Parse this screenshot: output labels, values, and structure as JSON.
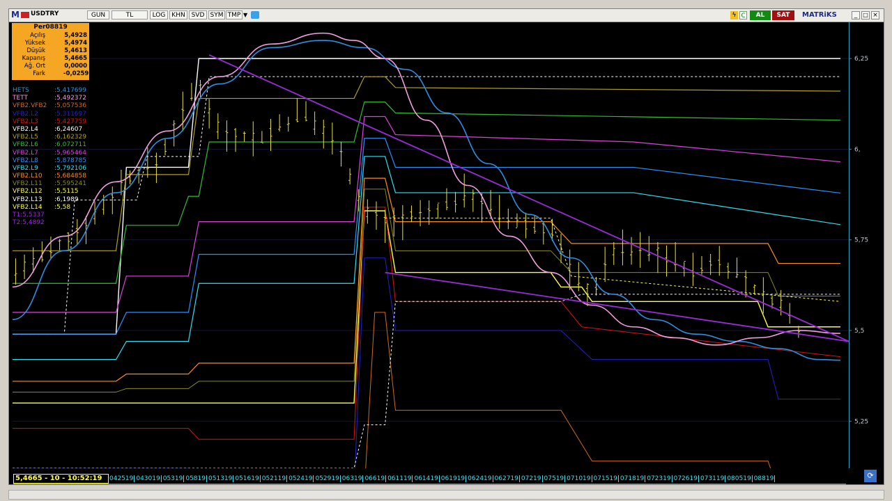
{
  "toolbar": {
    "symbol": "USDTRY",
    "buttons": [
      "GUN",
      "TL",
      "LOG",
      "KHN",
      "SVD",
      "SYM",
      "TMP"
    ],
    "al_label": "AL",
    "sat_label": "SAT",
    "brand": "MATRiKS"
  },
  "ohlc": {
    "title": "Per08819",
    "rows": [
      {
        "k": "Açılış",
        "v": "5,4928"
      },
      {
        "k": "Yüksek",
        "v": "5,4974"
      },
      {
        "k": "Düşük",
        "v": "5,4613"
      },
      {
        "k": "Kapanış",
        "v": "5,4665"
      },
      {
        "k": "Ağ. Ort",
        "v": "0,0000"
      },
      {
        "k": "Fark",
        "v": "-0,0259"
      }
    ]
  },
  "legend": [
    {
      "name": "HETS",
      "value": ":5,417699",
      "color": "#2d8fe0"
    },
    {
      "name": "TETT",
      "value": ":5,492372",
      "color": "#f29ee0"
    },
    {
      "name": "VFB2.VFB2",
      "value": ":5,057536",
      "color": "#d46a1a"
    },
    {
      "name": "VFB2.L2",
      "value": ":5,311697",
      "color": "#2222cc"
    },
    {
      "name": "VFB2.L3",
      "value": ":5,427759",
      "color": "#e01010"
    },
    {
      "name": "VFB2.L4",
      "value": ":6,24607",
      "color": "#ffffff"
    },
    {
      "name": "VFB2.L5",
      "value": ":6,162329",
      "color": "#b0a020"
    },
    {
      "name": "VFB2.L6",
      "value": ":6,072711",
      "color": "#2fbf2f"
    },
    {
      "name": "VFB2.L7",
      "value": ":5,965464",
      "color": "#e040e0"
    },
    {
      "name": "VFB2.L8",
      "value": ":5,878785",
      "color": "#2a90ff"
    },
    {
      "name": "VFB2.L9",
      "value": ":5,792106",
      "color": "#30e0f0"
    },
    {
      "name": "VFB2.L10",
      "value": ":5,684858",
      "color": "#ff8c1a"
    },
    {
      "name": "VFB2.L11",
      "value": ":5,595241",
      "color": "#8a8a1a"
    },
    {
      "name": "VFB2.L12",
      "value": ":5,5115",
      "color": "#ffff40"
    },
    {
      "name": "VFB2.L13",
      "value": ":6,1989",
      "color": "#ffffff"
    },
    {
      "name": "VFB2.L14",
      "value": ":5,58",
      "color": "#ffff40"
    },
    {
      "name": "T1:5,5337",
      "value": "",
      "color": "#9a2bd8"
    },
    {
      "name": "T2:5,4892",
      "value": "",
      "color": "#9a2bd8"
    }
  ],
  "ticker": {
    "current": "5,4665 - 10 - 10:52:19",
    "dates": [
      "042519",
      "043019",
      "05319",
      "05819",
      "051319",
      "051619",
      "052119",
      "052419",
      "052919",
      "06319",
      "06619",
      "061119",
      "061419",
      "061919",
      "062419",
      "062719",
      "07219",
      "07519",
      "071019",
      "071519",
      "071819",
      "072319",
      "072619",
      "073119",
      "080519",
      "08819"
    ]
  },
  "chart_data": {
    "type": "line",
    "ylim": [
      5.12,
      6.35
    ],
    "y_ticks": [
      "6,25",
      "6,",
      "5,75",
      "5,5",
      "5,25"
    ],
    "y_tick_values": [
      6.25,
      6.0,
      5.75,
      5.5,
      5.25
    ],
    "x_count": 80,
    "step_lines": [
      {
        "name": "L4",
        "color": "#ffffff",
        "width": 1.4,
        "dash": false,
        "points": [
          [
            0,
            5.49
          ],
          [
            10,
            5.49
          ],
          [
            11,
            5.95
          ],
          [
            17,
            5.95
          ],
          [
            18,
            6.25
          ],
          [
            80,
            6.25
          ]
        ]
      },
      {
        "name": "L13",
        "color": "#ffffff",
        "width": 1,
        "dash": true,
        "points": [
          [
            0,
            5.49
          ],
          [
            5,
            5.49
          ],
          [
            6,
            5.86
          ],
          [
            12,
            5.86
          ],
          [
            13,
            5.98
          ],
          [
            18,
            5.98
          ],
          [
            19,
            6.2
          ],
          [
            34,
            6.2
          ],
          [
            35,
            6.2
          ],
          [
            80,
            6.2
          ]
        ]
      },
      {
        "name": "L5",
        "color": "#b0a020",
        "width": 1.2,
        "dash": false,
        "points": [
          [
            0,
            5.72
          ],
          [
            10,
            5.72
          ],
          [
            11,
            5.93
          ],
          [
            17,
            5.93
          ],
          [
            18,
            6.14
          ],
          [
            33,
            6.14
          ],
          [
            34,
            6.2
          ],
          [
            36,
            6.2
          ],
          [
            37,
            6.17
          ],
          [
            80,
            6.16
          ]
        ]
      },
      {
        "name": "L6",
        "color": "#2fbf2f",
        "width": 1.2,
        "dash": false,
        "points": [
          [
            0,
            5.63
          ],
          [
            10,
            5.63
          ],
          [
            11,
            5.79
          ],
          [
            16,
            5.79
          ],
          [
            17,
            5.87
          ],
          [
            18,
            5.87
          ],
          [
            19,
            6.02
          ],
          [
            32,
            6.02
          ],
          [
            33,
            6.02
          ],
          [
            34,
            6.13
          ],
          [
            36,
            6.13
          ],
          [
            37,
            6.1
          ],
          [
            80,
            6.08
          ]
        ]
      },
      {
        "name": "L7",
        "color": "#e040e0",
        "width": 1.2,
        "dash": false,
        "points": [
          [
            0,
            5.55
          ],
          [
            10,
            5.55
          ],
          [
            11,
            5.65
          ],
          [
            17,
            5.65
          ],
          [
            18,
            5.8
          ],
          [
            33,
            5.8
          ],
          [
            34,
            6.09
          ],
          [
            36,
            6.09
          ],
          [
            37,
            6.04
          ],
          [
            60,
            6.02
          ],
          [
            80,
            5.965
          ]
        ]
      },
      {
        "name": "L8",
        "color": "#2a90ff",
        "width": 1.2,
        "dash": false,
        "points": [
          [
            0,
            5.49
          ],
          [
            10,
            5.49
          ],
          [
            11,
            5.55
          ],
          [
            17,
            5.55
          ],
          [
            18,
            5.71
          ],
          [
            33,
            5.71
          ],
          [
            34,
            6.03
          ],
          [
            36,
            6.03
          ],
          [
            37,
            5.95
          ],
          [
            60,
            5.95
          ],
          [
            80,
            5.879
          ]
        ]
      },
      {
        "name": "L9",
        "color": "#30e0f0",
        "width": 1.2,
        "dash": false,
        "points": [
          [
            0,
            5.42
          ],
          [
            10,
            5.42
          ],
          [
            11,
            5.47
          ],
          [
            17,
            5.47
          ],
          [
            18,
            5.63
          ],
          [
            33,
            5.63
          ],
          [
            34,
            5.98
          ],
          [
            36,
            5.98
          ],
          [
            37,
            5.88
          ],
          [
            60,
            5.88
          ],
          [
            80,
            5.792
          ]
        ]
      },
      {
        "name": "L10",
        "color": "#ff8c1a",
        "width": 1.2,
        "dash": false,
        "points": [
          [
            0,
            5.36
          ],
          [
            10,
            5.36
          ],
          [
            11,
            5.38
          ],
          [
            17,
            5.38
          ],
          [
            18,
            5.41
          ],
          [
            33,
            5.41
          ],
          [
            34,
            5.92
          ],
          [
            36,
            5.92
          ],
          [
            37,
            5.8
          ],
          [
            52,
            5.8
          ],
          [
            54,
            5.74
          ],
          [
            73,
            5.74
          ],
          [
            74,
            5.685
          ],
          [
            80,
            5.685
          ]
        ]
      },
      {
        "name": "L11",
        "color": "#8a8a1a",
        "width": 1,
        "dash": false,
        "points": [
          [
            0,
            5.33
          ],
          [
            10,
            5.33
          ],
          [
            11,
            5.34
          ],
          [
            17,
            5.34
          ],
          [
            18,
            5.36
          ],
          [
            33,
            5.36
          ],
          [
            34,
            5.89
          ],
          [
            36,
            5.89
          ],
          [
            37,
            5.72
          ],
          [
            52,
            5.72
          ],
          [
            54,
            5.66
          ],
          [
            73,
            5.66
          ],
          [
            74,
            5.595
          ],
          [
            80,
            5.595
          ]
        ]
      },
      {
        "name": "L12",
        "color": "#ffff40",
        "width": 1.4,
        "dash": false,
        "points": [
          [
            0,
            5.3
          ],
          [
            33,
            5.3
          ],
          [
            34,
            5.83
          ],
          [
            36,
            5.83
          ],
          [
            37,
            5.66
          ],
          [
            52,
            5.66
          ],
          [
            53,
            5.62
          ],
          [
            55,
            5.62
          ],
          [
            56,
            5.58
          ],
          [
            72,
            5.58
          ],
          [
            73,
            5.51
          ],
          [
            80,
            5.51
          ]
        ]
      },
      {
        "name": "L3",
        "color": "#e01010",
        "width": 1,
        "dash": false,
        "points": [
          [
            0,
            5.23
          ],
          [
            17,
            5.23
          ],
          [
            18,
            5.2
          ],
          [
            33,
            5.2
          ],
          [
            34,
            5.84
          ],
          [
            36,
            5.84
          ],
          [
            37,
            5.58
          ],
          [
            53,
            5.58
          ],
          [
            55,
            5.51
          ],
          [
            80,
            5.4277
          ]
        ]
      },
      {
        "name": "L2",
        "color": "#2222cc",
        "width": 1,
        "dash": false,
        "points": [
          [
            0,
            5.12
          ],
          [
            17,
            5.12
          ],
          [
            18,
            5.06
          ],
          [
            33,
            5.06
          ],
          [
            34,
            5.7
          ],
          [
            36,
            5.7
          ],
          [
            37,
            5.5
          ],
          [
            53,
            5.5
          ],
          [
            56,
            5.42
          ],
          [
            73,
            5.42
          ],
          [
            74,
            5.311
          ],
          [
            80,
            5.311
          ]
        ]
      },
      {
        "name": "VFB2",
        "color": "#d46a1a",
        "width": 1,
        "dash": false,
        "points": [
          [
            34,
            5.06
          ],
          [
            35,
            5.55
          ],
          [
            36,
            5.55
          ],
          [
            37,
            5.28
          ],
          [
            53,
            5.28
          ],
          [
            56,
            5.14
          ],
          [
            73,
            5.14
          ],
          [
            74,
            5.057
          ],
          [
            80,
            5.057
          ]
        ]
      },
      {
        "name": "Ldash2",
        "color": "#ffffff",
        "width": 1,
        "dash": true,
        "points": [
          [
            0,
            5.12
          ],
          [
            33,
            5.12
          ],
          [
            34,
            5.24
          ],
          [
            36,
            5.24
          ],
          [
            37,
            5.58
          ],
          [
            53,
            5.58
          ],
          [
            55,
            5.6
          ],
          [
            80,
            5.6
          ]
        ]
      },
      {
        "name": "Ldash3",
        "color": "#ffff40",
        "width": 1,
        "dash": true,
        "points": [
          [
            36,
            5.81
          ],
          [
            52,
            5.81
          ],
          [
            54,
            5.65
          ],
          [
            80,
            5.58
          ]
        ]
      }
    ],
    "curves": [
      {
        "name": "HETS",
        "color": "#2d8fe0",
        "width": 1.6,
        "points": [
          [
            0,
            5.53
          ],
          [
            5,
            5.72
          ],
          [
            10,
            5.88
          ],
          [
            15,
            6.03
          ],
          [
            20,
            6.18
          ],
          [
            25,
            6.28
          ],
          [
            30,
            6.3
          ],
          [
            34,
            6.28
          ],
          [
            38,
            6.22
          ],
          [
            42,
            6.1
          ],
          [
            46,
            5.96
          ],
          [
            50,
            5.82
          ],
          [
            54,
            5.7
          ],
          [
            58,
            5.6
          ],
          [
            62,
            5.53
          ],
          [
            66,
            5.49
          ],
          [
            70,
            5.47
          ],
          [
            74,
            5.45
          ],
          [
            78,
            5.42
          ],
          [
            80,
            5.418
          ]
        ]
      },
      {
        "name": "TETT",
        "color": "#f29ee0",
        "width": 1.6,
        "points": [
          [
            0,
            5.62
          ],
          [
            5,
            5.76
          ],
          [
            10,
            5.91
          ],
          [
            15,
            6.05
          ],
          [
            20,
            6.2
          ],
          [
            25,
            6.29
          ],
          [
            30,
            6.32
          ],
          [
            33,
            6.3
          ],
          [
            36,
            6.25
          ],
          [
            40,
            6.08
          ],
          [
            44,
            5.9
          ],
          [
            48,
            5.76
          ],
          [
            52,
            5.66
          ],
          [
            56,
            5.57
          ],
          [
            60,
            5.51
          ],
          [
            64,
            5.48
          ],
          [
            68,
            5.46
          ],
          [
            72,
            5.48
          ],
          [
            76,
            5.5
          ],
          [
            80,
            5.492
          ]
        ]
      }
    ],
    "trend_lines": [
      {
        "name": "T1",
        "color": "#9a2bd8",
        "from": [
          19,
          6.26
        ],
        "to": [
          83,
          5.47
        ]
      },
      {
        "name": "T2",
        "color": "#9a2bd8",
        "from": [
          36,
          5.66
        ],
        "to": [
          83,
          5.47
        ]
      }
    ],
    "candles_seed": 7
  }
}
